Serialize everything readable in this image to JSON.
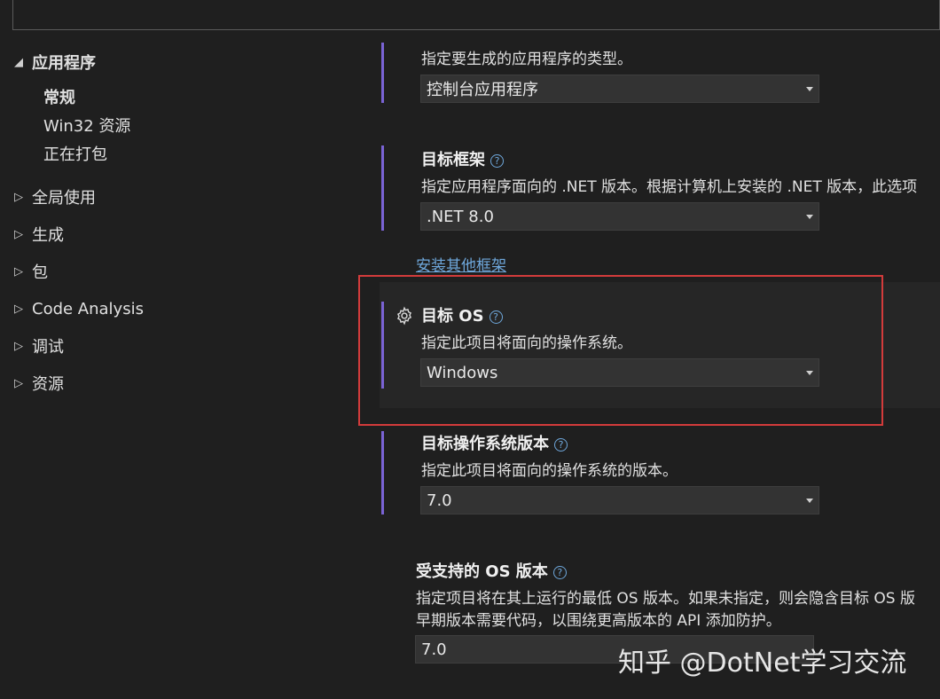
{
  "sidebar": {
    "app": "应用程序",
    "sub_items": [
      "常规",
      "Win32 资源",
      "正在打包"
    ],
    "items": [
      "全局使用",
      "生成",
      "包",
      "Code Analysis",
      "调试",
      "资源"
    ]
  },
  "output_type": {
    "description": "指定要生成的应用程序的类型。",
    "value": "控制台应用程序"
  },
  "target_framework": {
    "title": "目标框架",
    "description": "指定应用程序面向的 .NET 版本。根据计算机上安装的 .NET 版本，此选项",
    "value": ".NET 8.0",
    "install_link": "安装其他框架"
  },
  "target_os": {
    "title": "目标 OS",
    "description": "指定此项目将面向的操作系统。",
    "value": "Windows"
  },
  "target_os_version": {
    "title": "目标操作系统版本",
    "description": "指定此项目将面向的操作系统的版本。",
    "value": "7.0"
  },
  "supported_os_version": {
    "title": "受支持的 OS 版本",
    "description_line1": "指定项目将在其上运行的最低 OS 版本。如果未指定，则会隐含目标 OS 版",
    "description_line2": "早期版本需要代码，以围绕更高版本的 API 添加防护。",
    "value": "7.0"
  },
  "icons": {
    "help": "help-circle-icon",
    "gear": "gear-icon",
    "expand": "triangle-right-icon",
    "collapse": "triangle-down-icon"
  },
  "watermark": "知乎 @DotNet学习交流",
  "colors": {
    "accent_bar": "#7a63d4",
    "link": "#6fa8dc",
    "highlight_border": "#d33b3b"
  }
}
